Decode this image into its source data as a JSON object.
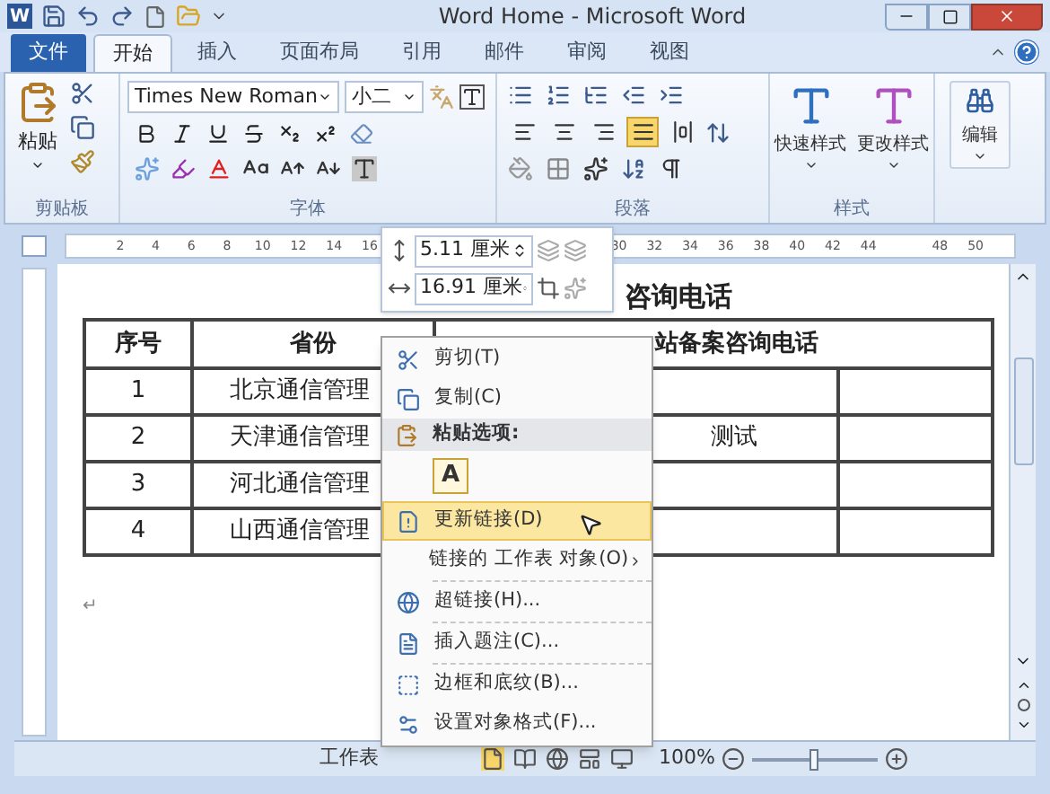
{
  "window": {
    "app_icon": "W",
    "title": "Word Home - Microsoft Word"
  },
  "tabs": [
    {
      "label": "文件",
      "kind": "file",
      "selected": false
    },
    {
      "label": "开始",
      "kind": "tab",
      "selected": true
    },
    {
      "label": "插入",
      "kind": "tab",
      "selected": false
    },
    {
      "label": "页面布局",
      "kind": "tab",
      "selected": false
    },
    {
      "label": "引用",
      "kind": "tab",
      "selected": false
    },
    {
      "label": "邮件",
      "kind": "tab",
      "selected": false
    },
    {
      "label": "审阅",
      "kind": "tab",
      "selected": false
    },
    {
      "label": "视图",
      "kind": "tab",
      "selected": false
    }
  ],
  "ribbon": {
    "clipboard": {
      "paste": "粘贴",
      "label": "剪贴板"
    },
    "font": {
      "name": "Times New Roman",
      "size": "小二",
      "label": "字体"
    },
    "paragraph": {
      "label": "段落",
      "alignment": [
        {
          "kind": "left",
          "selected": false
        },
        {
          "kind": "center",
          "selected": false
        },
        {
          "kind": "right",
          "selected": false
        },
        {
          "kind": "justify",
          "selected": true
        },
        {
          "kind": "distributed",
          "selected": false
        }
      ]
    },
    "styles": {
      "label": "样式",
      "buttons": [
        "快速样式",
        "更改样式"
      ]
    },
    "editing": {
      "label": "编辑"
    }
  },
  "ruler": {
    "segments": [
      [
        "2",
        "4",
        "6",
        "8",
        "10",
        "12",
        "14",
        "16"
      ],
      [
        "30",
        "32",
        "34",
        "36",
        "38",
        "40",
        "42",
        "44"
      ],
      [
        "48",
        "50"
      ]
    ]
  },
  "picture_toolbar": {
    "height": "5.11 厘米",
    "width": "16.91 厘米"
  },
  "document": {
    "title": "咨询电话",
    "table": {
      "header": [
        "序号",
        "省份",
        "站备案咨询电话"
      ],
      "rows": [
        [
          "1",
          "北京通信管理",
          "",
          ""
        ],
        [
          "2",
          "天津通信管理",
          "测试",
          ""
        ],
        [
          "3",
          "河北通信管理",
          "",
          ""
        ],
        [
          "4",
          "山西通信管理",
          "",
          ""
        ]
      ]
    },
    "paragraph_mark": "↵"
  },
  "context_menu": [
    {
      "kind": "item",
      "label": "剪切(T)",
      "selected": false
    },
    {
      "kind": "item",
      "label": "复制(C)",
      "selected": false
    },
    {
      "kind": "header",
      "label": "粘贴选项:"
    },
    {
      "kind": "paste_options",
      "options": [
        "A"
      ]
    },
    {
      "kind": "item",
      "label": "更新链接(D)",
      "selected": true
    },
    {
      "kind": "submenu",
      "label": "链接的 工作表 对象(O)",
      "selected": false
    },
    {
      "kind": "separator"
    },
    {
      "kind": "item",
      "label": "超链接(H)...",
      "selected": false
    },
    {
      "kind": "separator"
    },
    {
      "kind": "item",
      "label": "插入题注(C)...",
      "selected": false
    },
    {
      "kind": "separator"
    },
    {
      "kind": "item",
      "label": "边框和底纹(B)...",
      "selected": false
    },
    {
      "kind": "item",
      "label": "设置对象格式(F)...",
      "selected": false
    }
  ],
  "status_bar": {
    "text": "工作表",
    "zoom": "100%",
    "zoom_slider": {
      "level": 0.5
    }
  }
}
